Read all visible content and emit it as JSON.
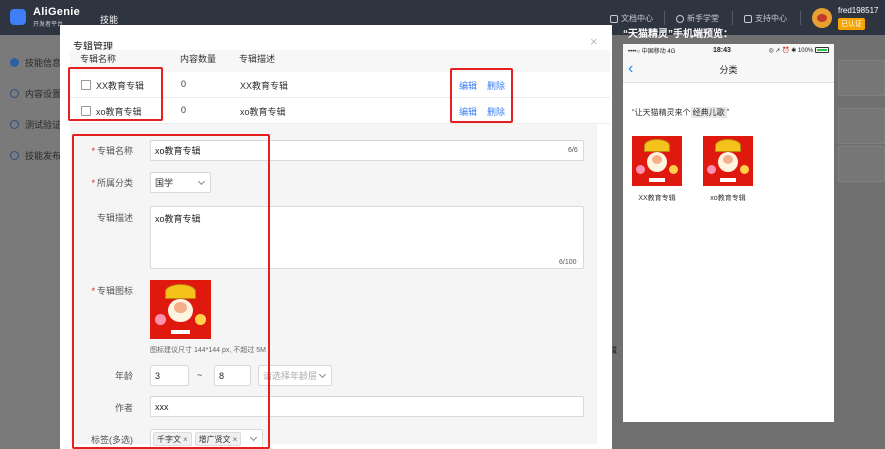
{
  "header": {
    "logo_title": "AliGenie",
    "logo_subtitle": "开发者平台",
    "nav_skill": "技能",
    "links": [
      "文档中心",
      "新手学堂",
      "支持中心"
    ],
    "username": "fred198517",
    "badge": "已认证"
  },
  "sidebar": {
    "items": [
      {
        "label": "技能信息",
        "icon": "check-circle-icon"
      },
      {
        "label": "内容设置",
        "icon": "circle-icon"
      },
      {
        "label": "测试验证",
        "icon": "circle-icon"
      },
      {
        "label": "技能发布",
        "icon": "circle-icon"
      }
    ]
  },
  "modal": {
    "title": "专辑管理",
    "close": "×",
    "columns": [
      "专辑名称",
      "内容数量",
      "专辑描述"
    ],
    "rows": [
      {
        "name": "XX教育专辑",
        "count": "0",
        "desc": "XX教育专辑",
        "edit": "编辑",
        "delete": "删除"
      },
      {
        "name": "xo教育专辑",
        "count": "0",
        "desc": "xo教育专辑",
        "edit": "编辑",
        "delete": "删除"
      }
    ],
    "form": {
      "name_label": "专辑名称",
      "name_value": "xo教育专辑",
      "name_counter": "6/6",
      "category_label": "所属分类",
      "category_value": "国学",
      "desc_label": "专辑描述",
      "desc_value": "xo教育专辑",
      "desc_counter": "6/100",
      "icon_label": "专辑图标",
      "icon_hint": "图标建议尺寸 144*144 px, 不超过 5M",
      "age_label": "年龄",
      "age_min": "3",
      "age_sep": "~",
      "age_max": "8",
      "age_layer_placeholder": "请选择年龄层",
      "author_label": "作者",
      "author_value": "xxx",
      "tags_label": "标签(多选)",
      "tags": [
        "千字文",
        "增广贤文"
      ]
    }
  },
  "preview": {
    "title": "“天猫精灵”手机端预览：",
    "status_left": "••••○ 中国移动  4G",
    "status_time": "18:43",
    "status_right": "◎ ➚ ⏰ ✱ 100%",
    "nav_back": "‹",
    "nav_title": "分类",
    "phrase_prefix": "“让天猫精灵来个",
    "phrase_highlight": "经典儿歌",
    "phrase_suffix": "”",
    "albums": [
      "XX教育专辑",
      "xo教育专辑"
    ]
  },
  "background": {
    "partial_text": "辑"
  },
  "colors": {
    "topbar": "#2f3441",
    "link": "#3a7ff5",
    "annotation": "#e62020",
    "required": "#e02020",
    "badge": "#f7a400"
  }
}
